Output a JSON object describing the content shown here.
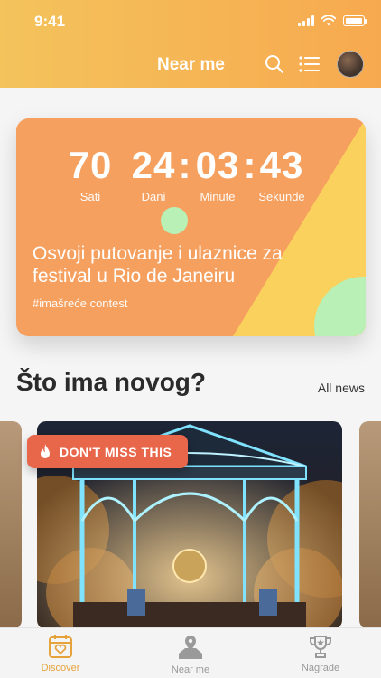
{
  "status": {
    "time": "9:41"
  },
  "nav": {
    "title": "Near me",
    "search_icon": "search-icon",
    "list_icon": "list-icon",
    "avatar": "user-avatar"
  },
  "promo": {
    "counter": [
      {
        "value": "70",
        "label": "Sati"
      },
      {
        "value": "24",
        "label": "Dani"
      },
      {
        "value": "03",
        "label": "Minute"
      },
      {
        "value": "43",
        "label": "Sekunde"
      }
    ],
    "title": "Osvoji putovanje i ulaznice za festival u Rio de Janeiru",
    "tag": "#imašreće contest",
    "colors": {
      "orange": "#f6a05f",
      "yellow": "#fbd15d",
      "mint": "#b8f0b6"
    }
  },
  "section": {
    "title": "Što ima novog?",
    "all_news": "All news"
  },
  "news": {
    "badge": "DON'T MISS THIS",
    "badge_icon": "flame-icon"
  },
  "tabs": [
    {
      "label": "Discover",
      "icon": "calendar-heart-icon"
    },
    {
      "label": "Near me",
      "icon": "map-pin-icon"
    },
    {
      "label": "Nagrade",
      "icon": "trophy-icon"
    }
  ],
  "accent": "#e6a33c"
}
